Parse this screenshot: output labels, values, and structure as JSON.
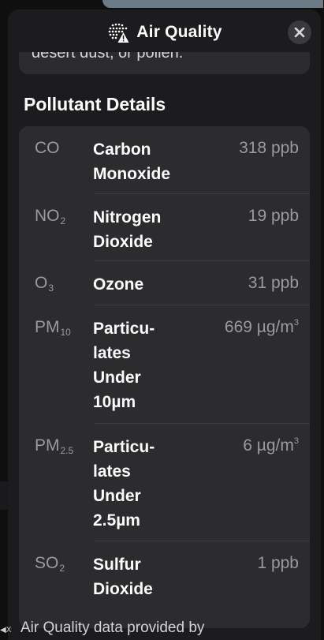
{
  "header": {
    "title": "Air Quality",
    "icon": "air-quality-warning-icon",
    "close_icon": "close-icon"
  },
  "previous_card": {
    "text": "desert dust, or pollen."
  },
  "section": {
    "title": "Pollutant Details"
  },
  "pollutants": [
    {
      "abbr": "CO",
      "abbr_sub": "",
      "name": "Carbon Monoxide",
      "value": "318 ppb",
      "value_sup": ""
    },
    {
      "abbr": "NO",
      "abbr_sub": "2",
      "name": "Nitrogen Dioxide",
      "value": "19 ppb",
      "value_sup": ""
    },
    {
      "abbr": "O",
      "abbr_sub": "3",
      "name": "Ozone",
      "value": "31 ppb",
      "value_sup": ""
    },
    {
      "abbr": "PM",
      "abbr_sub": "10",
      "name": "Particu- lates Under 10µm",
      "value": "669 µg/m",
      "value_sup": "3"
    },
    {
      "abbr": "PM",
      "abbr_sub": "2.5",
      "name": "Particu- lates Under 2.5µm",
      "value": "6 µg/m",
      "value_sup": "3"
    },
    {
      "abbr": "SO",
      "abbr_sub": "2",
      "name": "Sulfur Dioxide",
      "value": "1 ppb",
      "value_sup": ""
    }
  ],
  "footer": {
    "text": "Air Quality data provided by"
  },
  "corner": {
    "text": "X"
  }
}
